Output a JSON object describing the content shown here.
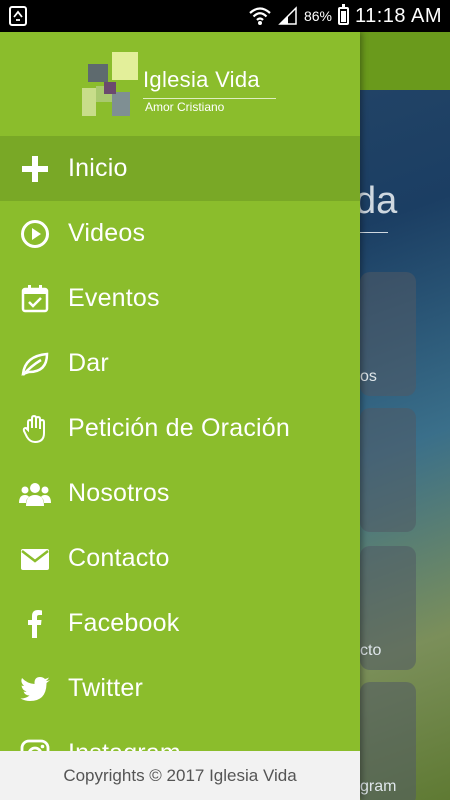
{
  "status_bar": {
    "battery": "86%",
    "time": "11:18 AM"
  },
  "brand": {
    "name": "Iglesia Vida",
    "tagline": "Amor Cristiano"
  },
  "background": {
    "title_fragment": "da",
    "tiles": [
      "os",
      "",
      "cto",
      "gram"
    ]
  },
  "menu": {
    "items": [
      {
        "label": "Inicio",
        "icon": "cross-icon"
      },
      {
        "label": "Videos",
        "icon": "play-circle-icon"
      },
      {
        "label": "Eventos",
        "icon": "calendar-check-icon"
      },
      {
        "label": "Dar",
        "icon": "leaf-icon"
      },
      {
        "label": "Petición de Oración",
        "icon": "hand-icon"
      },
      {
        "label": "Nosotros",
        "icon": "users-icon"
      },
      {
        "label": "Contacto",
        "icon": "envelope-icon"
      },
      {
        "label": "Facebook",
        "icon": "facebook-icon"
      },
      {
        "label": "Twitter",
        "icon": "twitter-icon"
      },
      {
        "label": "Instagram",
        "icon": "instagram-icon"
      }
    ]
  },
  "footer": {
    "text": "Copyrights © 2017 Iglesia Vida"
  },
  "colors": {
    "drawer": "#8bbd2c",
    "active_item": "#79a826",
    "toolbar": "#6a9a1c",
    "footer": "#f2f2f2"
  }
}
